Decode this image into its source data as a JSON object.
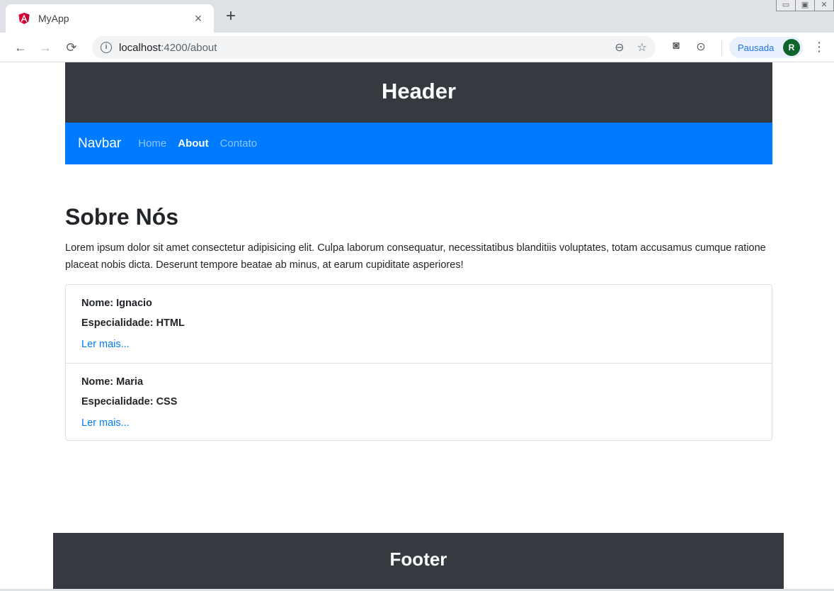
{
  "browser": {
    "tab_title": "MyApp",
    "tab_close": "×",
    "new_tab": "+",
    "url_host": "localhost",
    "url_path": ":4200/about",
    "profile_label": "Pausada",
    "avatar_initial": "R",
    "icons": [
      "angular-favicon",
      "back-icon",
      "forward-icon",
      "reload-icon",
      "info-icon",
      "zoom-icon",
      "star-icon",
      "camera-icon",
      "extension-icon",
      "menu-icon"
    ]
  },
  "header": {
    "title": "Header"
  },
  "navbar": {
    "brand": "Navbar",
    "links": [
      {
        "label": "Home",
        "active": false
      },
      {
        "label": "About",
        "active": true
      },
      {
        "label": "Contato",
        "active": false
      }
    ],
    "color": "#007bff"
  },
  "about": {
    "title": "Sobre Nós",
    "text": "Lorem ipsum dolor sit amet consectetur adipisicing elit. Culpa laborum consequatur, necessitatibus blanditiis voluptates, totam accusamus cumque ratione placeat nobis dicta. Deserunt tempore beatae ab minus, at earum cupiditate asperiores!"
  },
  "people": [
    {
      "name": "Nome: Ignacio",
      "specialty": "Especialidade: HTML",
      "link": "Ler mais..."
    },
    {
      "name": "Nome: Maria",
      "specialty": "Especialidade: CSS",
      "link": "Ler mais..."
    }
  ],
  "footer": {
    "title": "Footer"
  },
  "colors": {
    "dark": "#343a40",
    "primary": "#007bff"
  }
}
